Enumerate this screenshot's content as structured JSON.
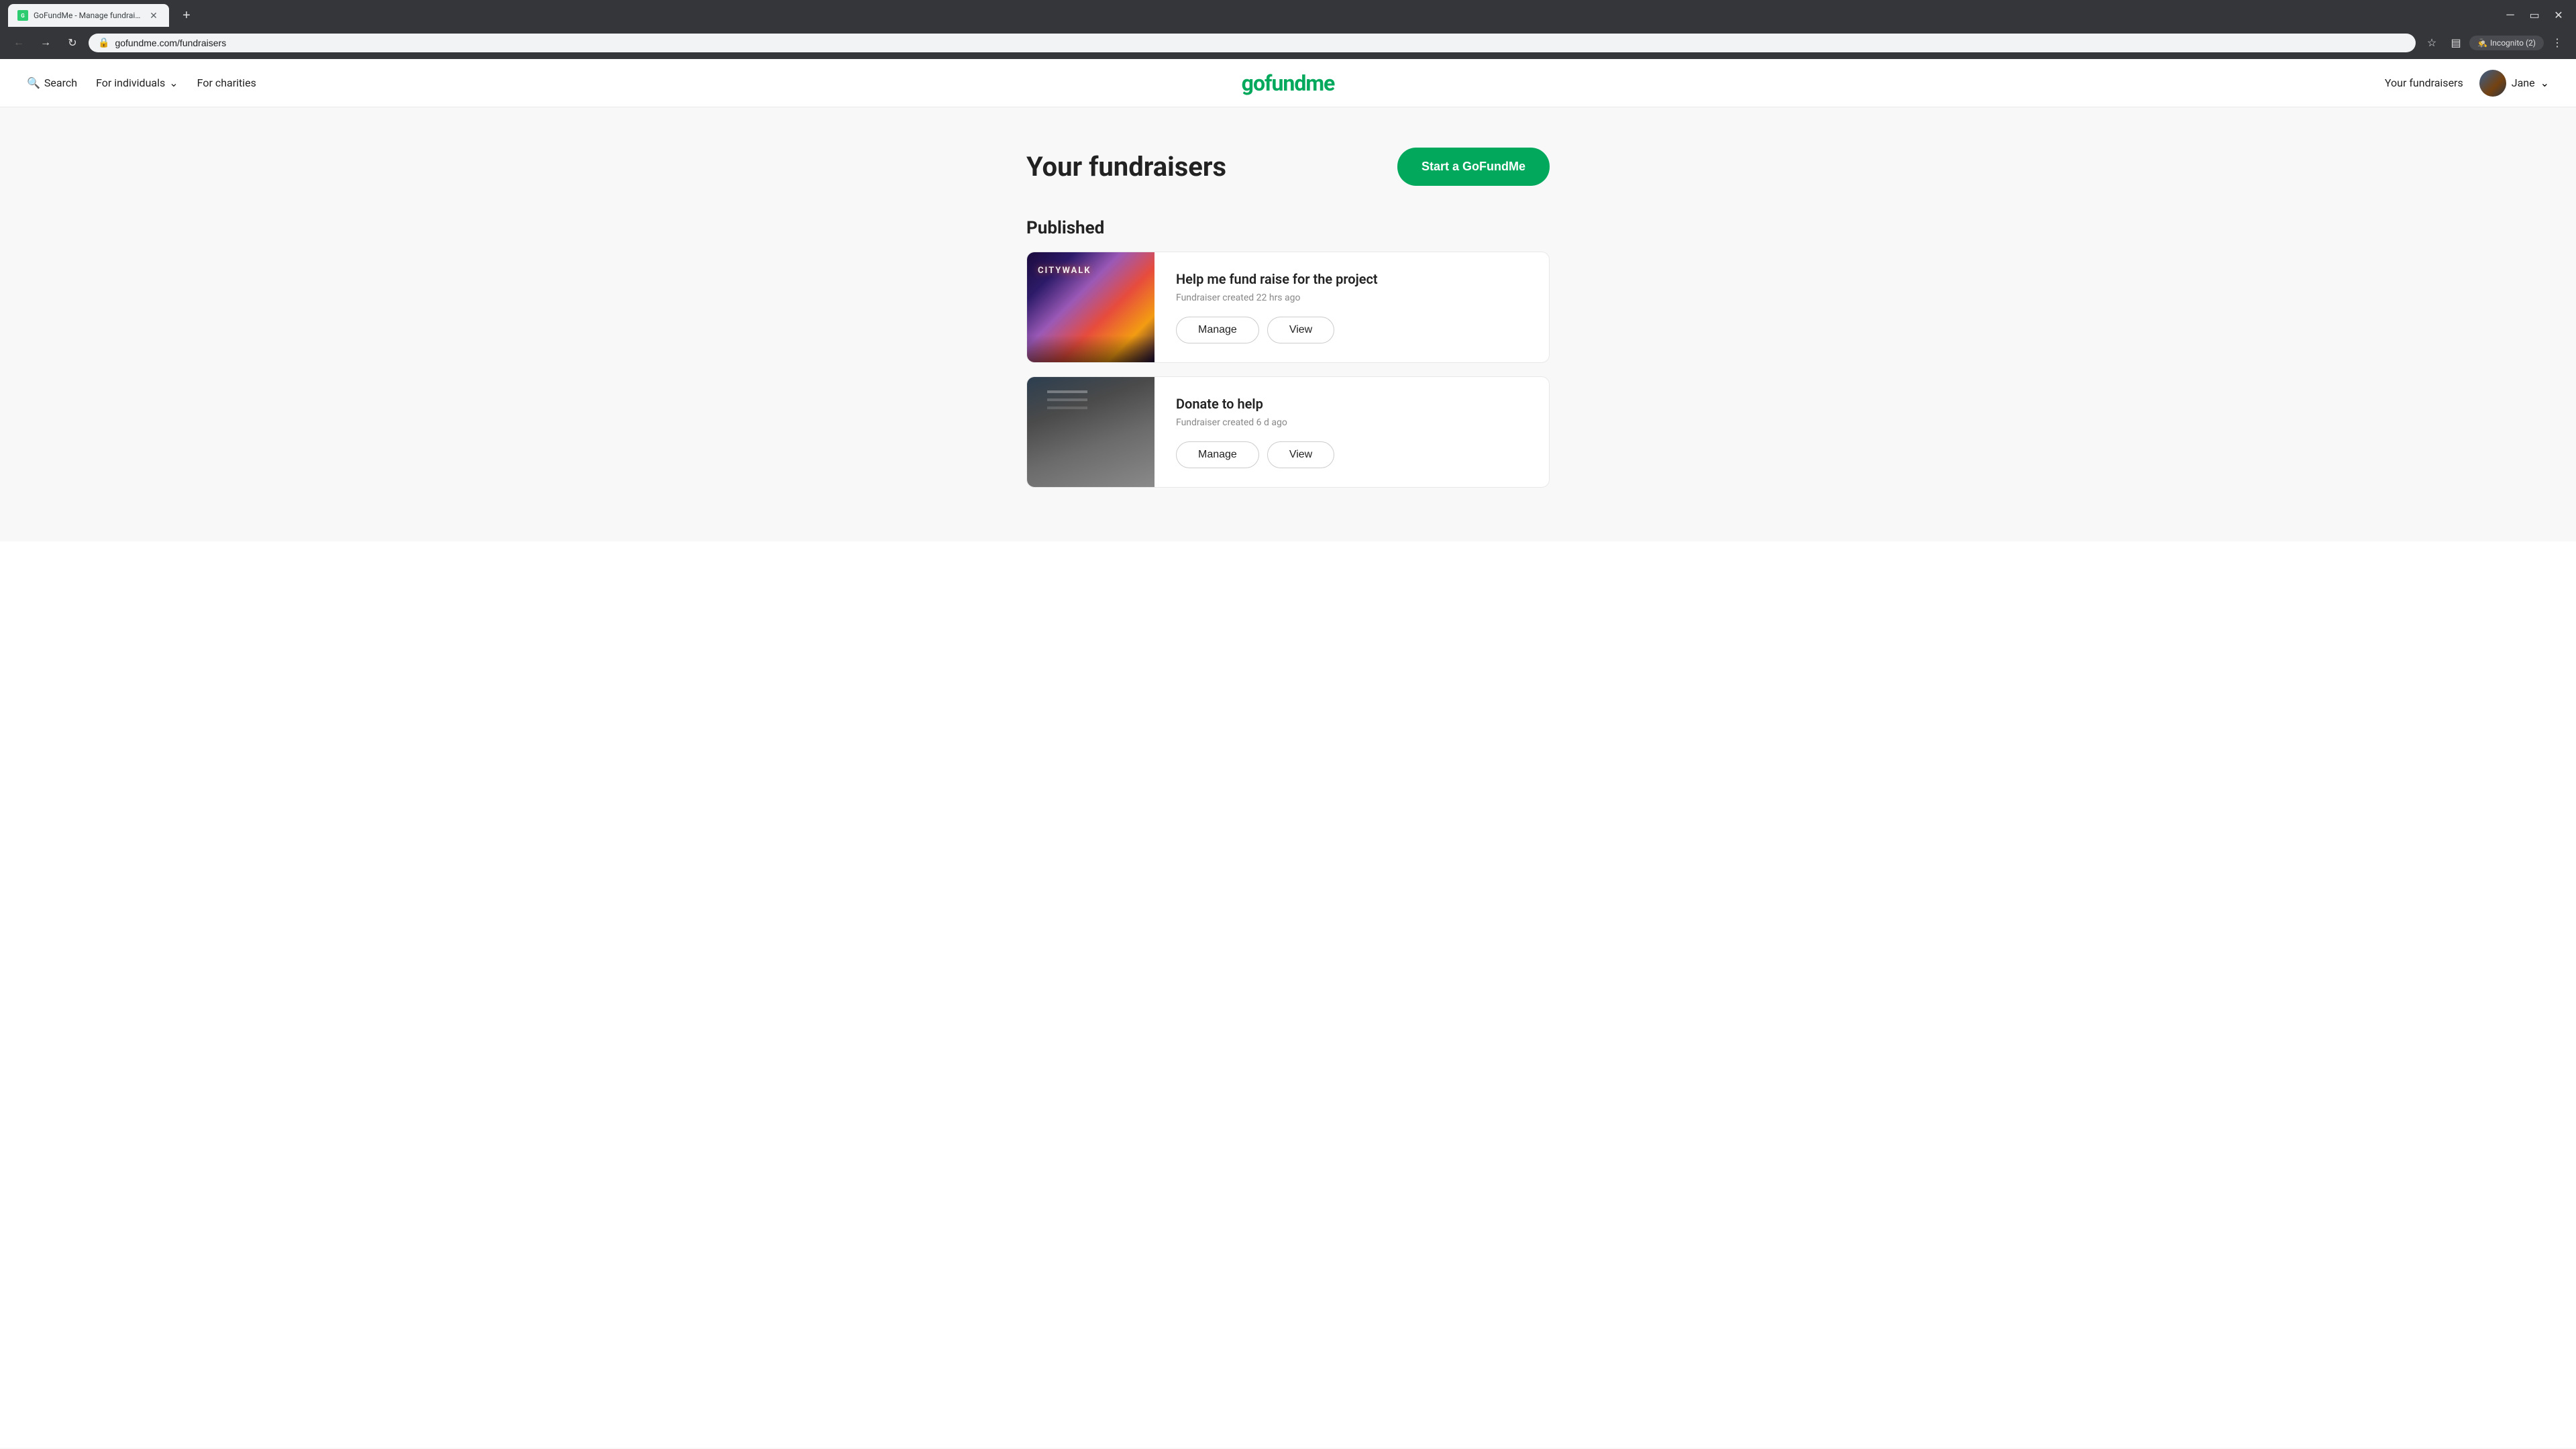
{
  "browser": {
    "tab_title": "GoFundMe - Manage fundraise...",
    "tab_favicon": "G",
    "url": "gofundme.com/fundraisers",
    "incognito_label": "Incognito (2)"
  },
  "nav": {
    "search_label": "Search",
    "for_individuals_label": "For individuals",
    "for_charities_label": "For charities",
    "logo_text": "gofundme",
    "your_fundraisers_label": "Your fundraisers",
    "user_name": "Jane"
  },
  "main": {
    "page_title": "Your fundraisers",
    "start_btn_label": "Start a GoFundMe",
    "published_section_label": "Published",
    "fundraisers": [
      {
        "title": "Help me fund raise for the project",
        "meta": "Fundraiser created 22 hrs ago",
        "manage_label": "Manage",
        "view_label": "View",
        "image_type": "citywalk"
      },
      {
        "title": "Donate to help",
        "meta": "Fundraiser created 6 d ago",
        "manage_label": "Manage",
        "view_label": "View",
        "image_type": "donate"
      }
    ]
  }
}
